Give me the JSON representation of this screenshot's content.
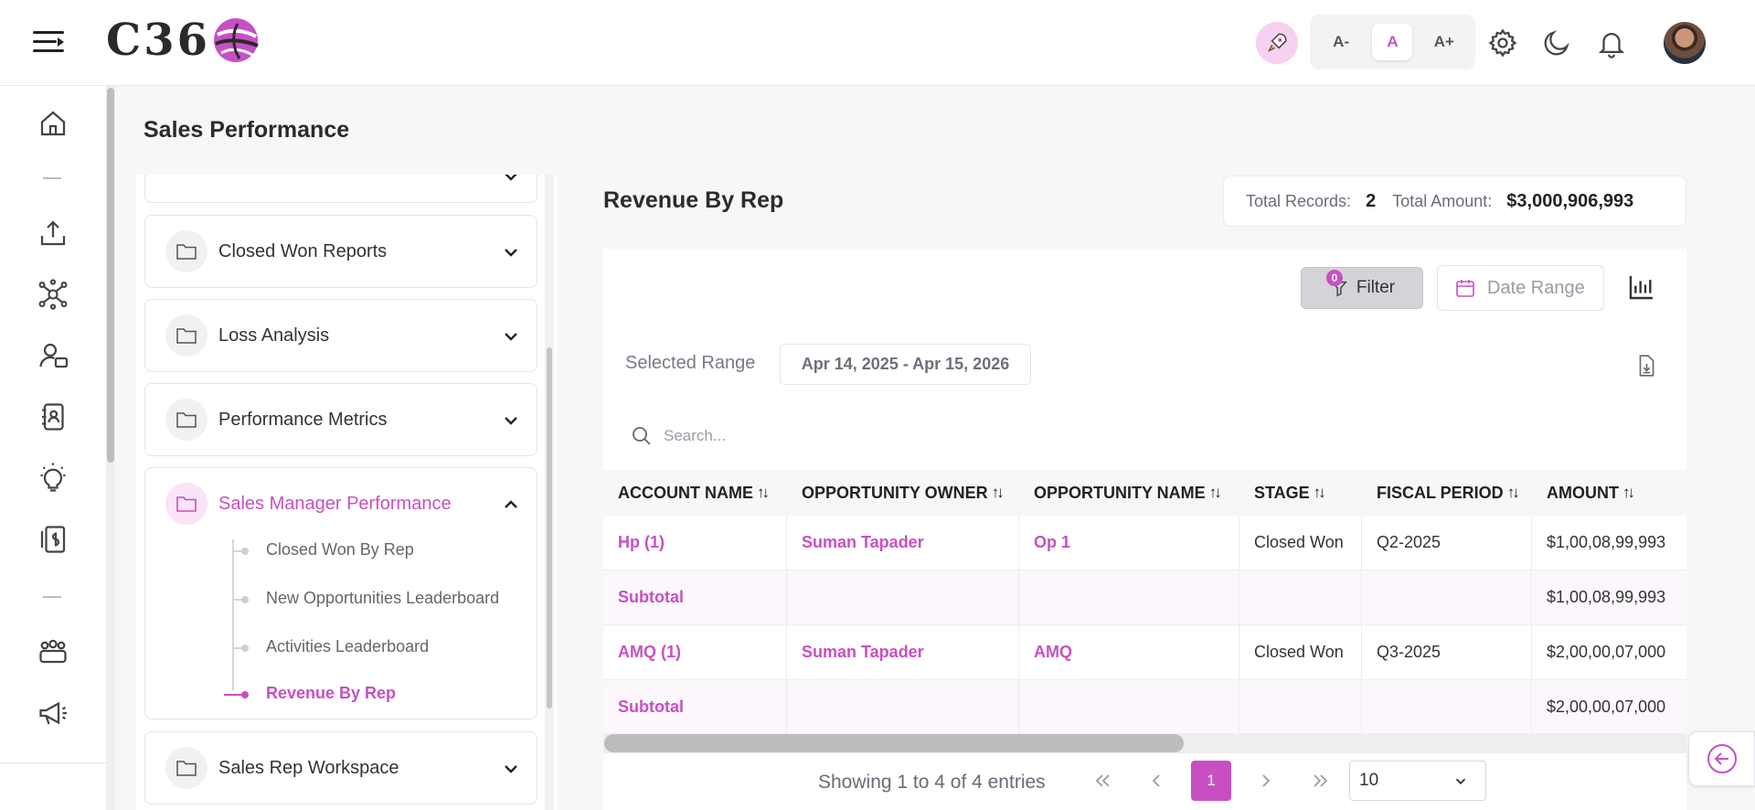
{
  "header": {
    "logo_text": "C36",
    "font_size": {
      "decrease": "A-",
      "normal": "A",
      "increase": "A+"
    }
  },
  "page": {
    "title": "Sales Performance"
  },
  "folders": [
    {
      "label": "Closed Won Reports",
      "expanded": false
    },
    {
      "label": "Loss Analysis",
      "expanded": false
    },
    {
      "label": "Performance Metrics",
      "expanded": false
    },
    {
      "label": "Sales Manager Performance",
      "expanded": true,
      "children": [
        "Closed Won By Rep",
        "New Opportunities Leaderboard",
        "Activities Leaderboard",
        "Revenue By Rep"
      ],
      "active_child": "Revenue By Rep"
    },
    {
      "label": "Sales Rep Workspace",
      "expanded": false
    }
  ],
  "report": {
    "title": "Revenue By Rep",
    "total_records_label": "Total Records:",
    "total_records": "2",
    "total_amount_label": "Total Amount:",
    "total_amount": "$3,000,906,993",
    "filter_label": "Filter",
    "filter_count": "0",
    "date_range_label": "Date Range",
    "selected_range_label": "Selected Range",
    "selected_range": "Apr 14, 2025 - Apr 15, 2026",
    "search_placeholder": "Search..."
  },
  "table": {
    "columns": [
      "ACCOUNT NAME",
      "OPPORTUNITY OWNER",
      "OPPORTUNITY NAME",
      "STAGE",
      "FISCAL PERIOD",
      "AMOUNT"
    ],
    "rows": [
      {
        "type": "data",
        "account": "Hp (1)",
        "owner": "Suman Tapader",
        "opportunity": "Op 1",
        "stage": "Closed Won",
        "period": "Q2-2025",
        "amount": "$1,00,08,99,993"
      },
      {
        "type": "subtotal",
        "account": "Subtotal",
        "owner": "",
        "opportunity": "",
        "stage": "",
        "period": "",
        "amount": "$1,00,08,99,993"
      },
      {
        "type": "data",
        "account": "AMQ (1)",
        "owner": "Suman Tapader",
        "opportunity": "AMQ",
        "stage": "Closed Won",
        "period": "Q3-2025",
        "amount": "$2,00,00,07,000"
      },
      {
        "type": "subtotal",
        "account": "Subtotal",
        "owner": "",
        "opportunity": "",
        "stage": "",
        "period": "",
        "amount": "$2,00,00,07,000"
      }
    ]
  },
  "pagination": {
    "showing": "Showing 1 to 4 of 4 entries",
    "current_page": "1",
    "page_size": "10"
  },
  "colors": {
    "accent": "#c84fc3",
    "accent_light": "#fbe3f8"
  }
}
